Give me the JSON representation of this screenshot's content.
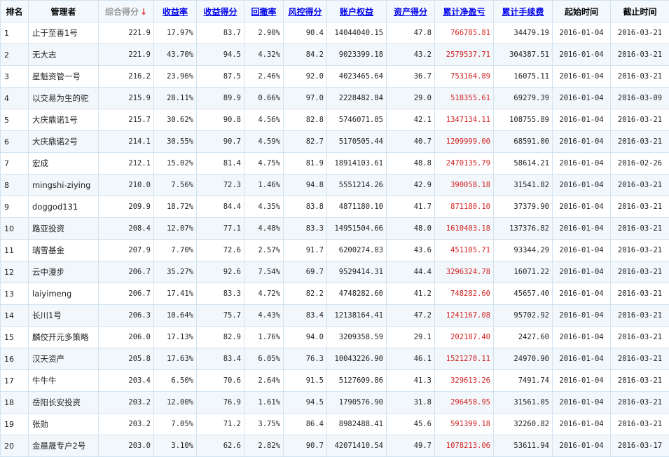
{
  "headers": {
    "rank": "排名",
    "manager": "管理者",
    "score": "综合得分",
    "sort_arrow": "↓",
    "return_rate": "收益率",
    "return_score": "收益得分",
    "drawdown": "回撤率",
    "risk_score": "风控得分",
    "equity": "账户权益",
    "asset_score": "资产得分",
    "net_profit": "累计净盈亏",
    "fees": "累计手续费",
    "start": "起始时间",
    "end": "截止时间"
  },
  "rows": [
    {
      "rank": "1",
      "manager": "止于至善1号",
      "score": "221.9",
      "return_rate": "17.97%",
      "return_score": "83.7",
      "drawdown": "2.90%",
      "risk_score": "90.4",
      "equity": "14044040.15",
      "asset_score": "47.8",
      "net_profit": "766785.81",
      "fees": "34479.19",
      "start": "2016-01-04",
      "end": "2016-03-21"
    },
    {
      "rank": "2",
      "manager": "无大志",
      "score": "221.9",
      "return_rate": "43.70%",
      "return_score": "94.5",
      "drawdown": "4.32%",
      "risk_score": "84.2",
      "equity": "9023399.18",
      "asset_score": "43.2",
      "net_profit": "2579537.71",
      "fees": "304387.51",
      "start": "2016-01-04",
      "end": "2016-03-21"
    },
    {
      "rank": "3",
      "manager": "星魁资管一号",
      "score": "216.2",
      "return_rate": "23.96%",
      "return_score": "87.5",
      "drawdown": "2.46%",
      "risk_score": "92.0",
      "equity": "4023465.64",
      "asset_score": "36.7",
      "net_profit": "753164.89",
      "fees": "16075.11",
      "start": "2016-01-04",
      "end": "2016-03-21"
    },
    {
      "rank": "4",
      "manager": "以交易为生的驼",
      "score": "215.9",
      "return_rate": "28.11%",
      "return_score": "89.9",
      "drawdown": "0.66%",
      "risk_score": "97.0",
      "equity": "2228482.84",
      "asset_score": "29.0",
      "net_profit": "518355.61",
      "fees": "69279.39",
      "start": "2016-01-04",
      "end": "2016-03-09"
    },
    {
      "rank": "5",
      "manager": "大庆鼎诺1号",
      "score": "215.7",
      "return_rate": "30.62%",
      "return_score": "90.8",
      "drawdown": "4.56%",
      "risk_score": "82.8",
      "equity": "5746071.85",
      "asset_score": "42.1",
      "net_profit": "1347134.11",
      "fees": "108755.89",
      "start": "2016-01-04",
      "end": "2016-03-21"
    },
    {
      "rank": "6",
      "manager": "大庆鼎诺2号",
      "score": "214.1",
      "return_rate": "30.55%",
      "return_score": "90.7",
      "drawdown": "4.59%",
      "risk_score": "82.7",
      "equity": "5170505.44",
      "asset_score": "40.7",
      "net_profit": "1209999.00",
      "fees": "68591.00",
      "start": "2016-01-04",
      "end": "2016-03-21"
    },
    {
      "rank": "7",
      "manager": "宏成",
      "score": "212.1",
      "return_rate": "15.02%",
      "return_score": "81.4",
      "drawdown": "4.75%",
      "risk_score": "81.9",
      "equity": "18914103.61",
      "asset_score": "48.8",
      "net_profit": "2470135.79",
      "fees": "58614.21",
      "start": "2016-01-04",
      "end": "2016-02-26"
    },
    {
      "rank": "8",
      "manager": "mingshi-ziying",
      "score": "210.0",
      "return_rate": "7.56%",
      "return_score": "72.3",
      "drawdown": "1.46%",
      "risk_score": "94.8",
      "equity": "5551214.26",
      "asset_score": "42.9",
      "net_profit": "390058.18",
      "fees": "31541.82",
      "start": "2016-01-04",
      "end": "2016-03-21"
    },
    {
      "rank": "9",
      "manager": "doggod131",
      "score": "209.9",
      "return_rate": "18.72%",
      "return_score": "84.4",
      "drawdown": "4.35%",
      "risk_score": "83.8",
      "equity": "4871180.10",
      "asset_score": "41.7",
      "net_profit": "871180.10",
      "fees": "37379.90",
      "start": "2016-01-04",
      "end": "2016-03-21"
    },
    {
      "rank": "10",
      "manager": "路亚投资",
      "score": "208.4",
      "return_rate": "12.07%",
      "return_score": "77.1",
      "drawdown": "4.48%",
      "risk_score": "83.3",
      "equity": "14951504.66",
      "asset_score": "48.0",
      "net_profit": "1610403.18",
      "fees": "137376.82",
      "start": "2016-01-04",
      "end": "2016-03-21"
    },
    {
      "rank": "11",
      "manager": "瑞雪基金",
      "score": "207.9",
      "return_rate": "7.70%",
      "return_score": "72.6",
      "drawdown": "2.57%",
      "risk_score": "91.7",
      "equity": "6200274.03",
      "asset_score": "43.6",
      "net_profit": "451105.71",
      "fees": "93344.29",
      "start": "2016-01-04",
      "end": "2016-03-21"
    },
    {
      "rank": "12",
      "manager": "云中漫步",
      "score": "206.7",
      "return_rate": "35.27%",
      "return_score": "92.6",
      "drawdown": "7.54%",
      "risk_score": "69.7",
      "equity": "9529414.31",
      "asset_score": "44.4",
      "net_profit": "3296324.78",
      "fees": "16071.22",
      "start": "2016-01-04",
      "end": "2016-03-21"
    },
    {
      "rank": "13",
      "manager": "laiyimeng",
      "score": "206.7",
      "return_rate": "17.41%",
      "return_score": "83.3",
      "drawdown": "4.72%",
      "risk_score": "82.2",
      "equity": "4748282.60",
      "asset_score": "41.2",
      "net_profit": "748282.60",
      "fees": "45657.40",
      "start": "2016-01-04",
      "end": "2016-03-21"
    },
    {
      "rank": "14",
      "manager": "长川1号",
      "score": "206.3",
      "return_rate": "10.64%",
      "return_score": "75.7",
      "drawdown": "4.43%",
      "risk_score": "83.4",
      "equity": "12138164.41",
      "asset_score": "47.2",
      "net_profit": "1241167.08",
      "fees": "95702.92",
      "start": "2016-01-04",
      "end": "2016-03-21"
    },
    {
      "rank": "15",
      "manager": "麟佼开元多策略",
      "score": "206.0",
      "return_rate": "17.13%",
      "return_score": "82.9",
      "drawdown": "1.76%",
      "risk_score": "94.0",
      "equity": "3209358.59",
      "asset_score": "29.1",
      "net_profit": "202187.40",
      "fees": "2427.60",
      "start": "2016-01-04",
      "end": "2016-03-21"
    },
    {
      "rank": "16",
      "manager": "汉天资产",
      "score": "205.8",
      "return_rate": "17.63%",
      "return_score": "83.4",
      "drawdown": "6.05%",
      "risk_score": "76.3",
      "equity": "10043226.90",
      "asset_score": "46.1",
      "net_profit": "1521270.11",
      "fees": "24970.90",
      "start": "2016-01-04",
      "end": "2016-03-21"
    },
    {
      "rank": "17",
      "manager": "牛牛牛",
      "score": "203.4",
      "return_rate": "6.50%",
      "return_score": "70.6",
      "drawdown": "2.64%",
      "risk_score": "91.5",
      "equity": "5127609.86",
      "asset_score": "41.3",
      "net_profit": "329613.26",
      "fees": "7491.74",
      "start": "2016-01-04",
      "end": "2016-03-21"
    },
    {
      "rank": "18",
      "manager": "岳阳长安投资",
      "score": "203.2",
      "return_rate": "12.00%",
      "return_score": "76.9",
      "drawdown": "1.61%",
      "risk_score": "94.5",
      "equity": "1790576.90",
      "asset_score": "31.8",
      "net_profit": "296458.95",
      "fees": "31561.05",
      "start": "2016-01-04",
      "end": "2016-03-21"
    },
    {
      "rank": "19",
      "manager": "张勋",
      "score": "203.2",
      "return_rate": "7.05%",
      "return_score": "71.2",
      "drawdown": "3.75%",
      "risk_score": "86.4",
      "equity": "8982488.41",
      "asset_score": "45.6",
      "net_profit": "591399.18",
      "fees": "32260.82",
      "start": "2016-01-04",
      "end": "2016-03-21"
    },
    {
      "rank": "20",
      "manager": "金晨晟专户2号",
      "score": "203.0",
      "return_rate": "3.10%",
      "return_score": "62.6",
      "drawdown": "2.82%",
      "risk_score": "90.7",
      "equity": "42071410.54",
      "asset_score": "49.7",
      "net_profit": "1078213.06",
      "fees": "53611.94",
      "start": "2016-01-04",
      "end": "2016-03-17"
    }
  ]
}
